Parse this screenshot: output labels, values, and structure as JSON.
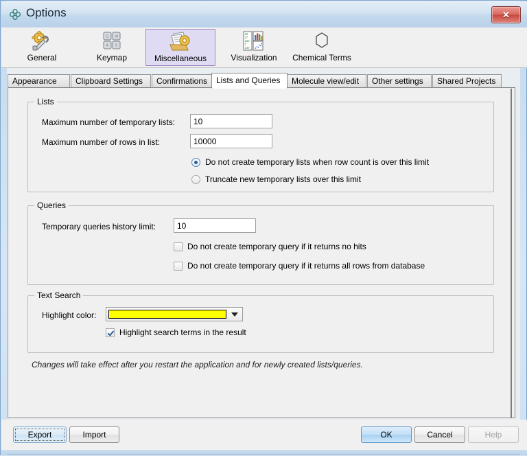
{
  "window": {
    "title": "Options",
    "icon": "molecule-icon",
    "close_label": "✕"
  },
  "toolbar": {
    "items": [
      {
        "label": "General",
        "icon": "gear-wrench-icon",
        "selected": false
      },
      {
        "label": "Keymap",
        "icon": "keyboard-keys-icon",
        "selected": false
      },
      {
        "label": "Miscellaneous",
        "icon": "documents-gear-icon",
        "selected": true
      },
      {
        "label": "Visualization",
        "icon": "charts-icon",
        "selected": false
      },
      {
        "label": "Chemical Terms",
        "icon": "benzene-ring-icon",
        "selected": false
      }
    ]
  },
  "tabs": [
    {
      "label": "Appearance",
      "active": false
    },
    {
      "label": "Clipboard Settings",
      "active": false
    },
    {
      "label": "Confirmations",
      "active": false
    },
    {
      "label": "Lists and Queries",
      "active": true
    },
    {
      "label": "Molecule view/edit",
      "active": false
    },
    {
      "label": "Other settings",
      "active": false
    },
    {
      "label": "Shared Projects",
      "active": false
    }
  ],
  "lists_group": {
    "title": "Lists",
    "max_temp_lists_label": "Maximum number of temporary lists:",
    "max_temp_lists_value": "10",
    "max_rows_label": "Maximum number of rows in list:",
    "max_rows_value": "10000",
    "radio_no_create_label": "Do not create temporary lists when row count is over this limit",
    "radio_no_create_checked": true,
    "radio_truncate_label": "Truncate new temporary lists over this limit",
    "radio_truncate_checked": false
  },
  "queries_group": {
    "title": "Queries",
    "history_limit_label": "Temporary queries history limit:",
    "history_limit_value": "10",
    "check_no_hits_label": "Do not create temporary query if it returns no hits",
    "check_no_hits_checked": false,
    "check_all_rows_label": "Do not create temporary query if it returns all rows from database",
    "check_all_rows_checked": false
  },
  "text_search_group": {
    "title": "Text Search",
    "highlight_color_label": "Highlight color:",
    "highlight_color_value": "#FFFF00",
    "check_highlight_label": "Highlight search terms in the result",
    "check_highlight_checked": true
  },
  "note": "Changes will take effect after you restart the application and for newly created lists/queries.",
  "buttons": {
    "export": "Export",
    "import": "Import",
    "ok": "OK",
    "cancel": "Cancel",
    "help": "Help"
  }
}
